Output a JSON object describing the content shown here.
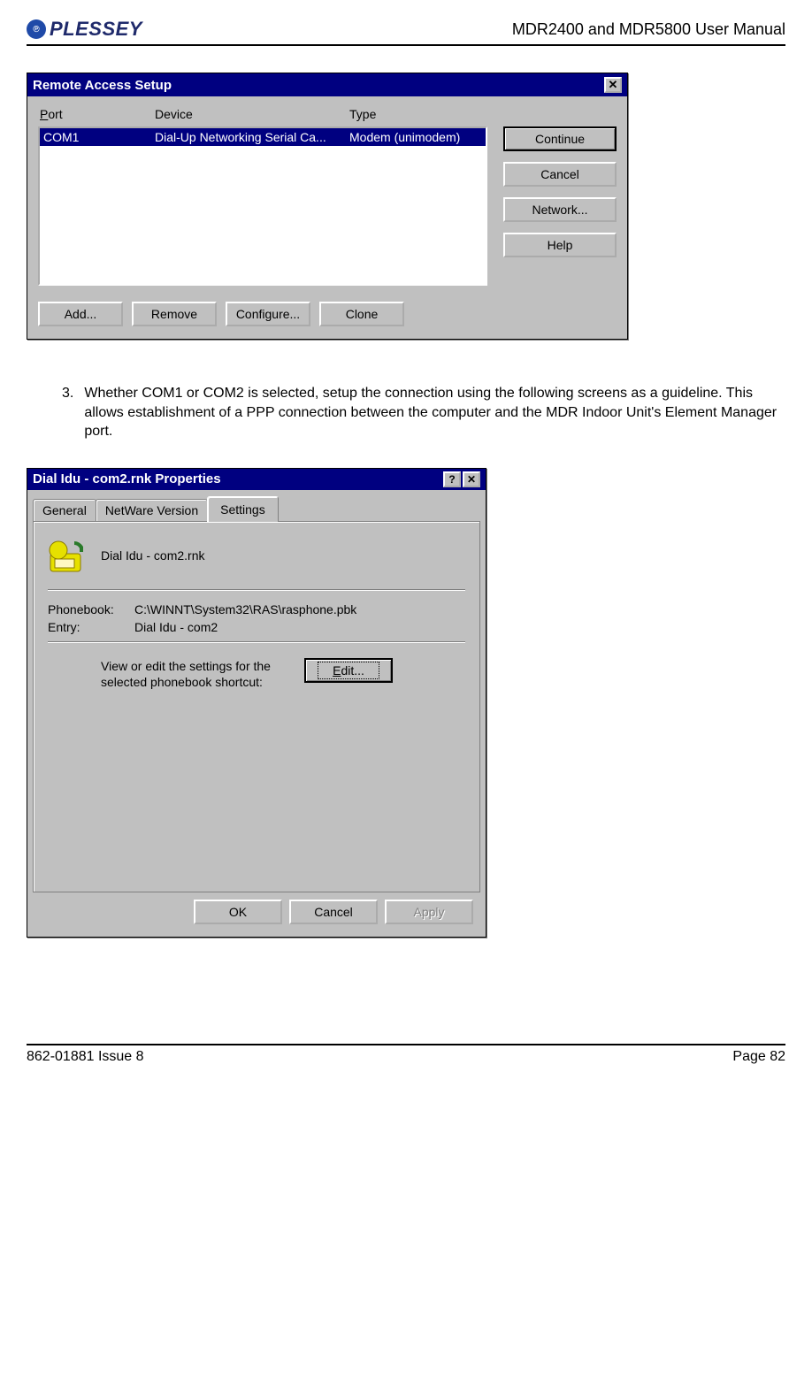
{
  "header": {
    "logo_text": "PLESSEY",
    "logo_badge_text": "℗",
    "doc_title": "MDR2400 and MDR5800 User Manual"
  },
  "dialog1": {
    "title": "Remote Access Setup",
    "close_glyph": "✕",
    "columns": {
      "c1": "Port",
      "c2": "Device",
      "c3": "Type"
    },
    "row": {
      "port": "COM1",
      "device": "Dial-Up Networking Serial Ca...",
      "type": "Modem (unimodem)"
    },
    "buttons_side": {
      "continue": "Continue",
      "cancel": "Cancel",
      "network": "Network...",
      "help": "Help"
    },
    "buttons_bottom": {
      "add": "Add...",
      "remove": "Remove",
      "configure": "Configure...",
      "clone": "Clone"
    }
  },
  "paragraph": {
    "num": "3.",
    "text": "Whether COM1 or COM2 is selected, setup the connection using the following screens as a guideline.  This allows establishment of a PPP connection between the computer and the MDR Indoor Unit's Element Manager port."
  },
  "dialog2": {
    "title": "Dial Idu - com2.rnk Properties",
    "help_glyph": "?",
    "close_glyph": "✕",
    "tabs": {
      "general": "General",
      "netware": "NetWare Version",
      "settings": "Settings"
    },
    "shortcut_name": "Dial Idu - com2.rnk",
    "phonebook_label": "Phonebook:",
    "phonebook_value": "C:\\WINNT\\System32\\RAS\\rasphone.pbk",
    "entry_label": "Entry:",
    "entry_value": "Dial Idu - com2",
    "edit_text": "View or edit the settings for the selected phonebook shortcut:",
    "edit_button": "Edit...",
    "footer": {
      "ok": "OK",
      "cancel": "Cancel",
      "apply": "Apply"
    }
  },
  "footer": {
    "left": "862-01881 Issue 8",
    "right": "Page 82"
  }
}
